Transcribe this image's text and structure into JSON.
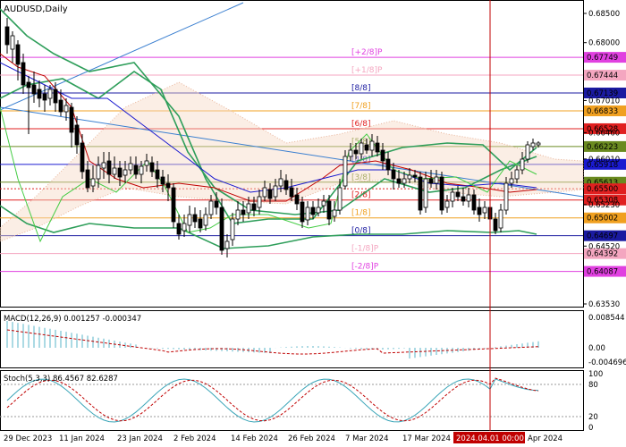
{
  "symbol_title": "AUDUSD,Daily",
  "price_axis": {
    "ticks": [
      "0.68500",
      "0.68000",
      "0.67010",
      "0.66460",
      "0.66010",
      "0.65230",
      "0.64520",
      "0.63530"
    ]
  },
  "murray_levels": [
    {
      "label": "[+2/8]P",
      "price": "0.67749",
      "color": "#e040e0"
    },
    {
      "label": "[+1/8]P",
      "price": "0.67444",
      "color": "#f4a6c0"
    },
    {
      "label": "[8/8]",
      "price": "0.67139",
      "color": "#1a1aa0"
    },
    {
      "label": "[7/8]",
      "price": "0.66833",
      "color": "#f0a020"
    },
    {
      "label": "[6/8]",
      "price": "0.66528",
      "color": "#e02020"
    },
    {
      "label": "[5/8]",
      "price": "0.66223",
      "color": "#6a8a20"
    },
    {
      "label": "[4/8]",
      "price": "0.65918",
      "color": "#1a1ad0"
    },
    {
      "label": "[3/8]",
      "price": "0.65613",
      "color": "#6a8a20"
    },
    {
      "label": "[2/8]",
      "price": "0.65308",
      "color": "#e02020"
    },
    {
      "label": "[1/8]",
      "price": "0.65002",
      "color": "#f0a020"
    },
    {
      "label": "[0/8]",
      "price": "0.64697",
      "color": "#1a1aa0"
    },
    {
      "label": "[-1/8]P",
      "price": "0.64392",
      "color": "#f4a6c0"
    },
    {
      "label": "[-2/8]P",
      "price": "0.64087",
      "color": "#e040e0"
    }
  ],
  "extra_price_tags": [
    {
      "price": "0.65500",
      "color": "#e02020"
    }
  ],
  "macd": {
    "label": "MACD(12,26,9) 0.001257 -0.000347",
    "axis": [
      "0.008544",
      "0.00",
      "-0.004696"
    ]
  },
  "stoch": {
    "label": "Stoch(5,3,3) 86.4567 82.6287",
    "axis": [
      "100",
      "80",
      "20",
      "0"
    ]
  },
  "date_axis": [
    "29 Dec 2023",
    "11 Jan 2024",
    "23 Jan 2024",
    "2 Feb 2024",
    "14 Feb 2024",
    "26 Feb 2024",
    "7 Mar 2024",
    "17 Mar 2024",
    "2024.04.01 00:00",
    "Apr 2024"
  ],
  "cursor_date": "2024.04.01 00:00",
  "colors": {
    "up": "#ffffff",
    "down": "#000000",
    "cursor": "#c00000",
    "bb": "#2e9e5a",
    "ma_fast": "#c00000",
    "ma_slow": "#1a1ad0",
    "env": "#44cc44"
  }
}
